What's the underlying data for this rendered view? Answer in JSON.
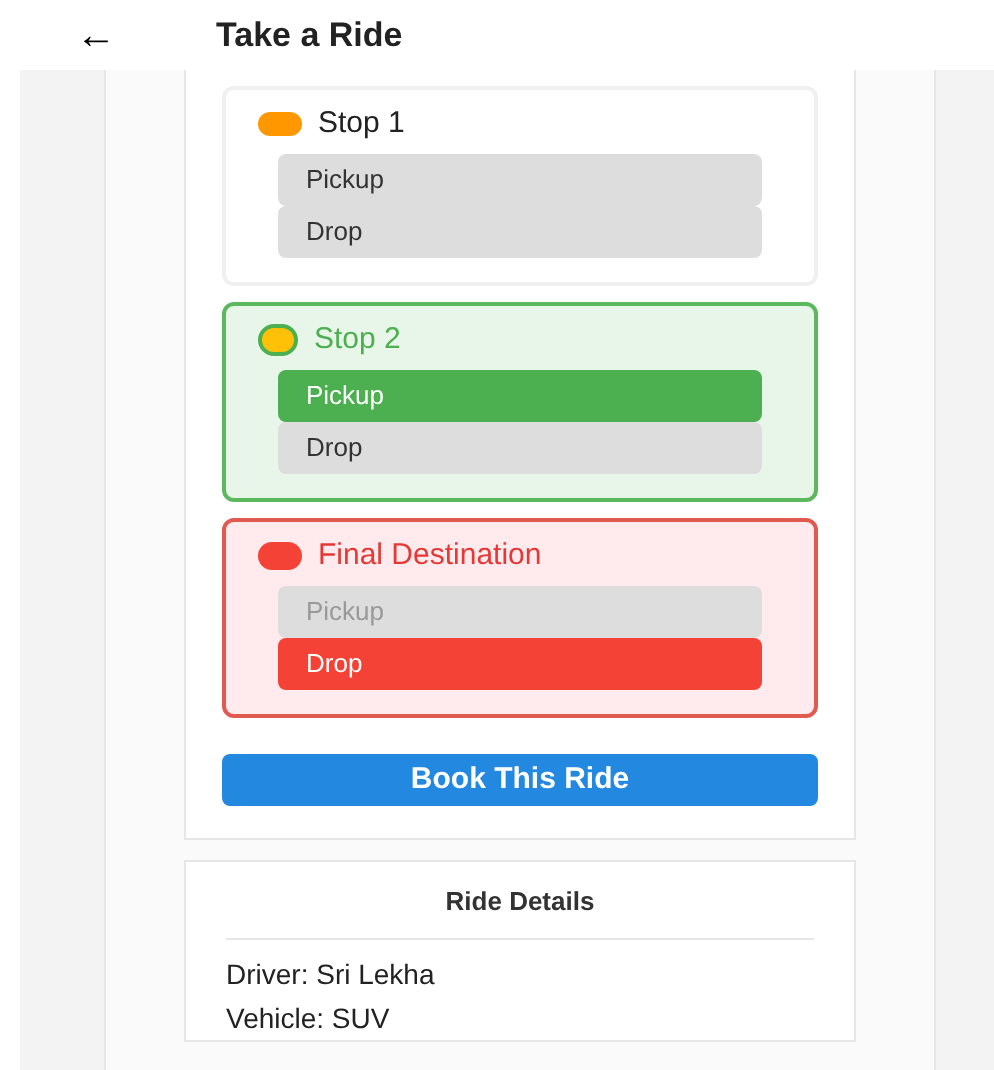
{
  "header": {
    "back": "←",
    "title": "Take a Ride"
  },
  "stops": [
    {
      "label": "Stop 1",
      "kind": "plain",
      "color": "#ff9800",
      "options": [
        {
          "label": "Pickup",
          "selected": false,
          "disabled": false
        },
        {
          "label": "Drop",
          "selected": false,
          "disabled": false
        }
      ]
    },
    {
      "label": "Stop 2",
      "kind": "pickup",
      "color": "#ffc107",
      "options": [
        {
          "label": "Pickup",
          "selected": true,
          "disabled": false
        },
        {
          "label": "Drop",
          "selected": false,
          "disabled": false
        }
      ]
    },
    {
      "label": "Final Destination",
      "kind": "destination",
      "color": "#f44336",
      "options": [
        {
          "label": "Pickup",
          "selected": false,
          "disabled": true
        },
        {
          "label": "Drop",
          "selected": true,
          "disabled": false
        }
      ]
    }
  ],
  "book_button": "Book This Ride",
  "details": {
    "title": "Ride Details",
    "lines": [
      "Driver: Sri Lekha",
      "Vehicle: SUV"
    ]
  }
}
